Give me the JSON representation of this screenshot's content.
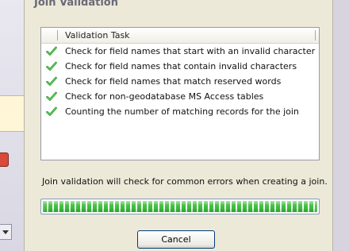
{
  "dialog": {
    "title": "Join Validation"
  },
  "task_list": {
    "column_header": "Validation Task",
    "items": [
      {
        "label": "Check for field names that start with an invalid character",
        "status": "complete"
      },
      {
        "label": "Check for field names that contain invalid characters",
        "status": "complete"
      },
      {
        "label": "Check for field names that match reserved words",
        "status": "complete"
      },
      {
        "label": "Check for non-geodatabase MS Access tables",
        "status": "complete"
      },
      {
        "label": "Counting the number of matching records for the join",
        "status": "complete"
      }
    ]
  },
  "status_message": "Join validation will check for common errors when creating a join.",
  "progress": {
    "fraction": 1.0,
    "color": "#3fbf3f"
  },
  "buttons": {
    "cancel_label": "Cancel"
  },
  "icons": {
    "task_status": "green-check-icon"
  }
}
